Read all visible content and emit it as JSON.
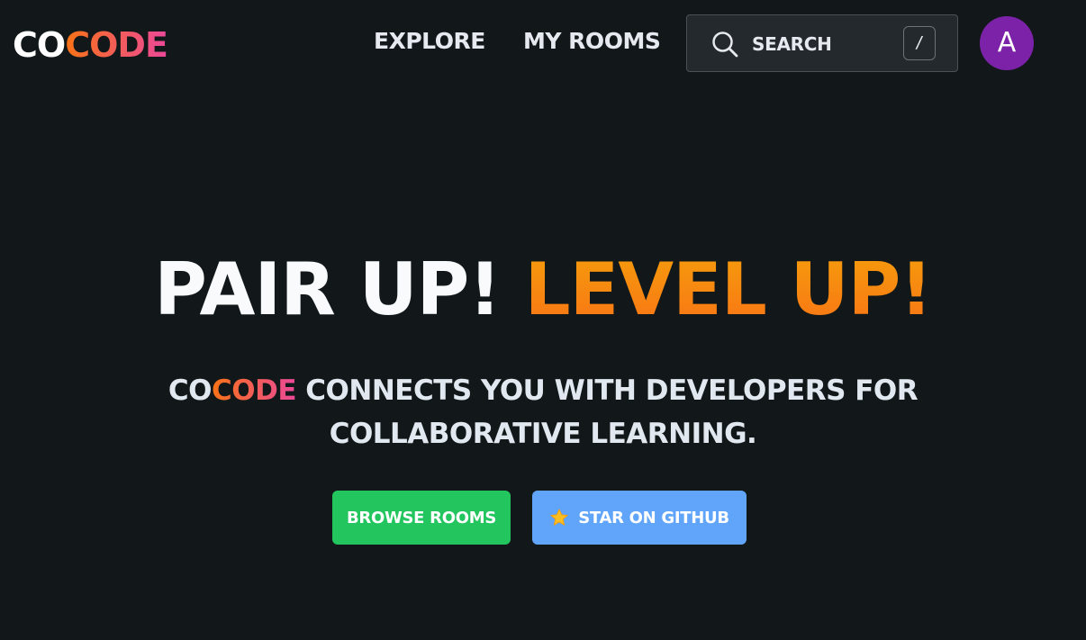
{
  "nav": {
    "logo_part1": "CO",
    "logo_part2": "CODE",
    "links": [
      {
        "label": "EXPLORE"
      },
      {
        "label": "MY ROOMS"
      }
    ],
    "search": {
      "placeholder": "SEARCH",
      "shortcut": "/",
      "icon": "search-icon"
    },
    "avatar_letter": "A"
  },
  "hero": {
    "title_part1": "PAIR UP!",
    "title_part2": "LEVEL UP!",
    "subtitle_brand1": "CO",
    "subtitle_brand2": "CODE",
    "subtitle_rest": " CONNECTS YOU WITH DEVELOPERS FOR COLLABORATIVE LEARNING."
  },
  "actions": {
    "browse_label": "BROWSE ROOMS",
    "star_label": "STAR ON GITHUB",
    "star_icon": "star-icon"
  },
  "colors": {
    "background": "#121819",
    "accent_orange": "#f97316",
    "accent_pink": "#ec4899",
    "browse_button": "#22c55e",
    "star_button": "#60a5fa",
    "avatar": "#7b22a8"
  }
}
